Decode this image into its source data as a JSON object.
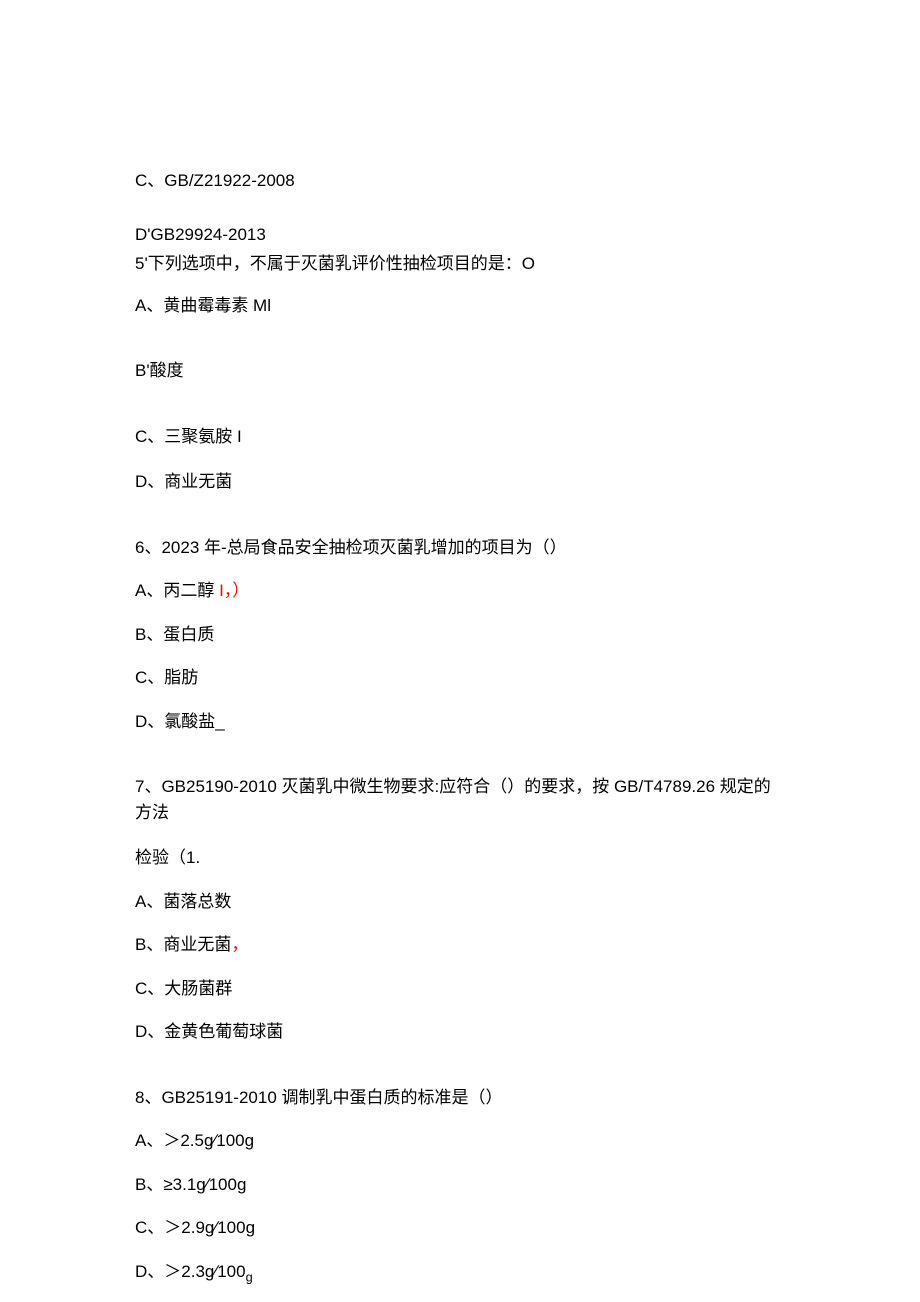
{
  "q4": {
    "optC": "C、GB/Z21922-2008",
    "optD_prefix": "D'GB29924-2013"
  },
  "q5": {
    "stem": "5'下列选项中，不属于灭菌乳评价性抽检项目的是：O",
    "optA": "A、黄曲霉毒素 Ml",
    "optB": "B'酸度",
    "optC": "C、三聚氨胺 I",
    "optD": "D、商业无菌"
  },
  "q6": {
    "stem": "6、2023 年-总局食品安全抽检项灭菌乳增加的项目为（）",
    "optA_pre": "A、丙二醇 ",
    "optA_red": "I，）",
    "optB": "B、蛋白质",
    "optC": "C、脂肪",
    "optD": "D、氯酸盐_"
  },
  "q7": {
    "stem": "7、GB25190-2010 灭菌乳中微生物要求:应符合（）的要求，按 GB/T4789.26 规定的方法",
    "stem2": "检验（1.",
    "optA": "A、菌落总数",
    "optB_pre": "B、商业无菌",
    "optB_red": "，",
    "optC": "C、大肠菌群",
    "optD": "D、金黄色葡萄球菌"
  },
  "q8": {
    "stem": "8、GB25191-2010 调制乳中蛋白质的标准是（）",
    "optA": "A、＞2.5g∕100g",
    "optB": "B、≥3.1g∕100g",
    "optC": "C、＞2.9g∕100g",
    "optD_pre": "D、＞2.3g∕100",
    "optD_sub": "g"
  }
}
